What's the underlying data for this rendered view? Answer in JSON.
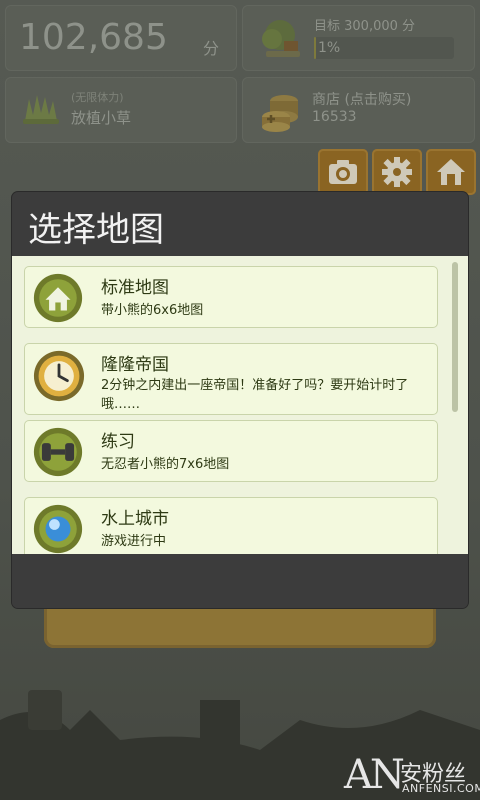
{
  "score": {
    "value": "102,685",
    "unit": "分"
  },
  "goal": {
    "label": "目标 300,000 分",
    "percent_text": "1%",
    "progress": 0.01
  },
  "plant": {
    "sub": "(无限体力)",
    "label": "放植小草"
  },
  "shop": {
    "title": "商店 (点击购买)",
    "coins": "16533"
  },
  "toolbar": {
    "camera_icon": "camera-icon",
    "settings_icon": "gear-icon",
    "home_icon": "home-icon"
  },
  "dialog": {
    "title": "选择地图",
    "items": [
      {
        "title": "标准地图",
        "desc": "带小熊的6x6地图",
        "icon": "house-icon"
      },
      {
        "title": "隆隆帝国",
        "desc": "2分钟之内建出一座帝国！准备好了吗？要开始计时了哦……",
        "icon": "clock-icon"
      },
      {
        "title": "练习",
        "desc": "无忍者小熊的7x6地图",
        "icon": "dumbbell-icon"
      },
      {
        "title": "水上城市",
        "desc": "游戏进行中",
        "icon": "water-orb-icon"
      }
    ]
  },
  "watermark": {
    "brand": "AN",
    "cn": "安粉丝",
    "url": "ANFENSI.COM"
  },
  "colors": {
    "accent": "#8a6422",
    "list_bg": "#eef3dd",
    "item_bg": "#f3f9de",
    "dialog_bg": "#3c3c3c",
    "icon_ring": "#6e7a2a"
  }
}
